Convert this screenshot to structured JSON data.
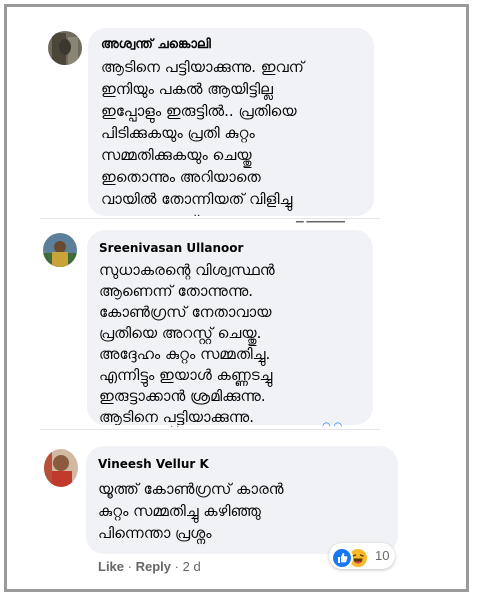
{
  "comments": [
    {
      "author": "അശ്വന്ത് ചങ്കൊലി",
      "text": "ആടിനെ പട്ടിയാക്കുന്നു. ഇവന്\nഇനിയും പകൽ ആയിട്ടില്ല\nഇപ്പോളും ഇരുട്ടിൽ.. പ്രതിയെ\nപിടിക്കുകയും പ്രതി കുറ്റം\nസമ്മതിക്കുകയും ചെയ്തു\nഇതൊന്നും അറിയാതെ\nവായിൽ തോന്നിയത് വിളിച്ചു\nപറയുകയാണ് നായ"
    },
    {
      "author": "Sreenivasan Ullanoor",
      "text": "സുധാകരന്റെ വിശ്വസ്ഥൻ\nആണെന്ന് തോന്നുന്നു.\nകോൺഗ്രസ് നേതാവായ\nപ്രതിയെ അറസ്റ്റ് ചെയ്തു.\nഅദ്ദേഹം കുറ്റം സമ്മതിച്ചു.\nഎന്നിട്ടും ഇയാൾ കണ്ണടച്ചു\nഇരുട്ടാക്കാൻ ശ്രമിക്കുന്നു.\nആടിനെ പട്ടിയാക്കുന്നു."
    },
    {
      "author": "Vineesh Vellur K",
      "text": "യൂത്ത് കോൺഗ്രസ് കാരൻ\nകുറ്റം സമ്മതിച്ചു കഴിഞ്ഞു\nപിന്നെന്താ പ്രശ്നം",
      "actions": {
        "like": "Like",
        "separator": "·",
        "reply": "Reply",
        "time": "2 d"
      },
      "reactions": {
        "icons": [
          "like-icon",
          "haha-icon"
        ],
        "count": "10"
      }
    }
  ],
  "colors": {
    "bubble": "#f0f2f5",
    "text": "#050505",
    "meta": "#65676b",
    "like": "#1877f2",
    "haha": "#f7b928",
    "frame": "#9a9a9a"
  }
}
